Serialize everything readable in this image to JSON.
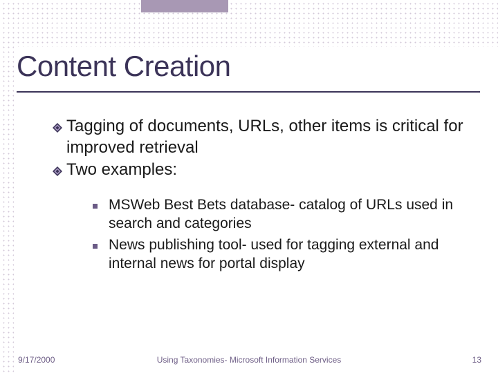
{
  "title": "Content Creation",
  "bullets": [
    {
      "text": "Tagging of documents, URLs, other items is critical for improved retrieval"
    },
    {
      "text": "Two examples:"
    }
  ],
  "sub_bullets": [
    {
      "text": "MSWeb Best Bets database- catalog of URLs used in search and categories"
    },
    {
      "text": "News publishing tool- used for tagging external and internal news for portal display"
    }
  ],
  "footer": {
    "date": "9/17/2000",
    "center": "Using Taxonomies- Microsoft Information Services",
    "page": "13"
  },
  "colors": {
    "title": "#3b3358",
    "accent": "#a898b4",
    "bullet_square": "#6b5b86",
    "footer": "#6f5f87"
  }
}
